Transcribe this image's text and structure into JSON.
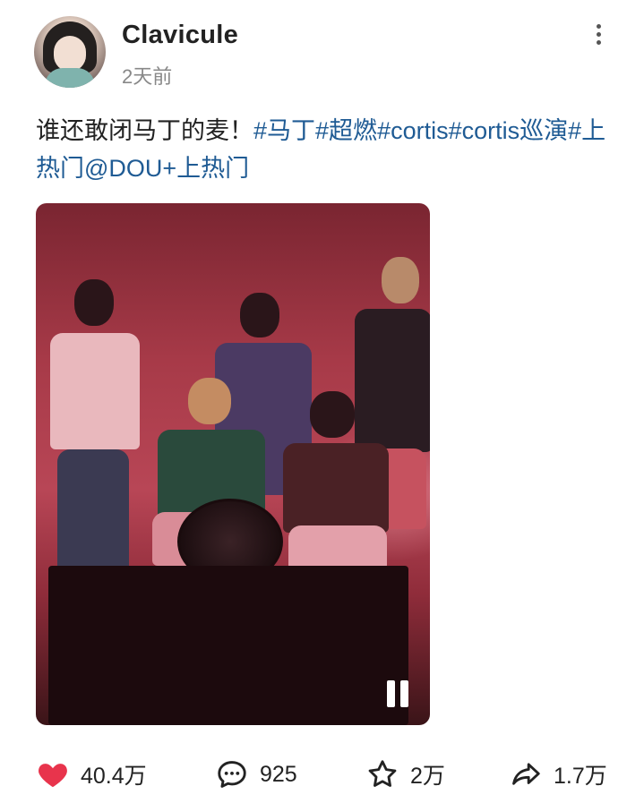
{
  "post": {
    "username": "Clavicule",
    "timestamp": "2天前",
    "text_plain": "谁还敢闭马丁的麦！",
    "tags": [
      "#马丁",
      "#超燃",
      "#cortis",
      "#cortis巡演",
      "#上热门"
    ],
    "mention": "@DOU+上热门"
  },
  "video": {
    "state": "playing",
    "control_icon": "pause-icon"
  },
  "actions": {
    "likes": "40.4万",
    "comments": "925",
    "favorites": "2万",
    "shares": "1.7万"
  },
  "colors": {
    "tag": "#1f5b94",
    "like": "#e8344c"
  }
}
